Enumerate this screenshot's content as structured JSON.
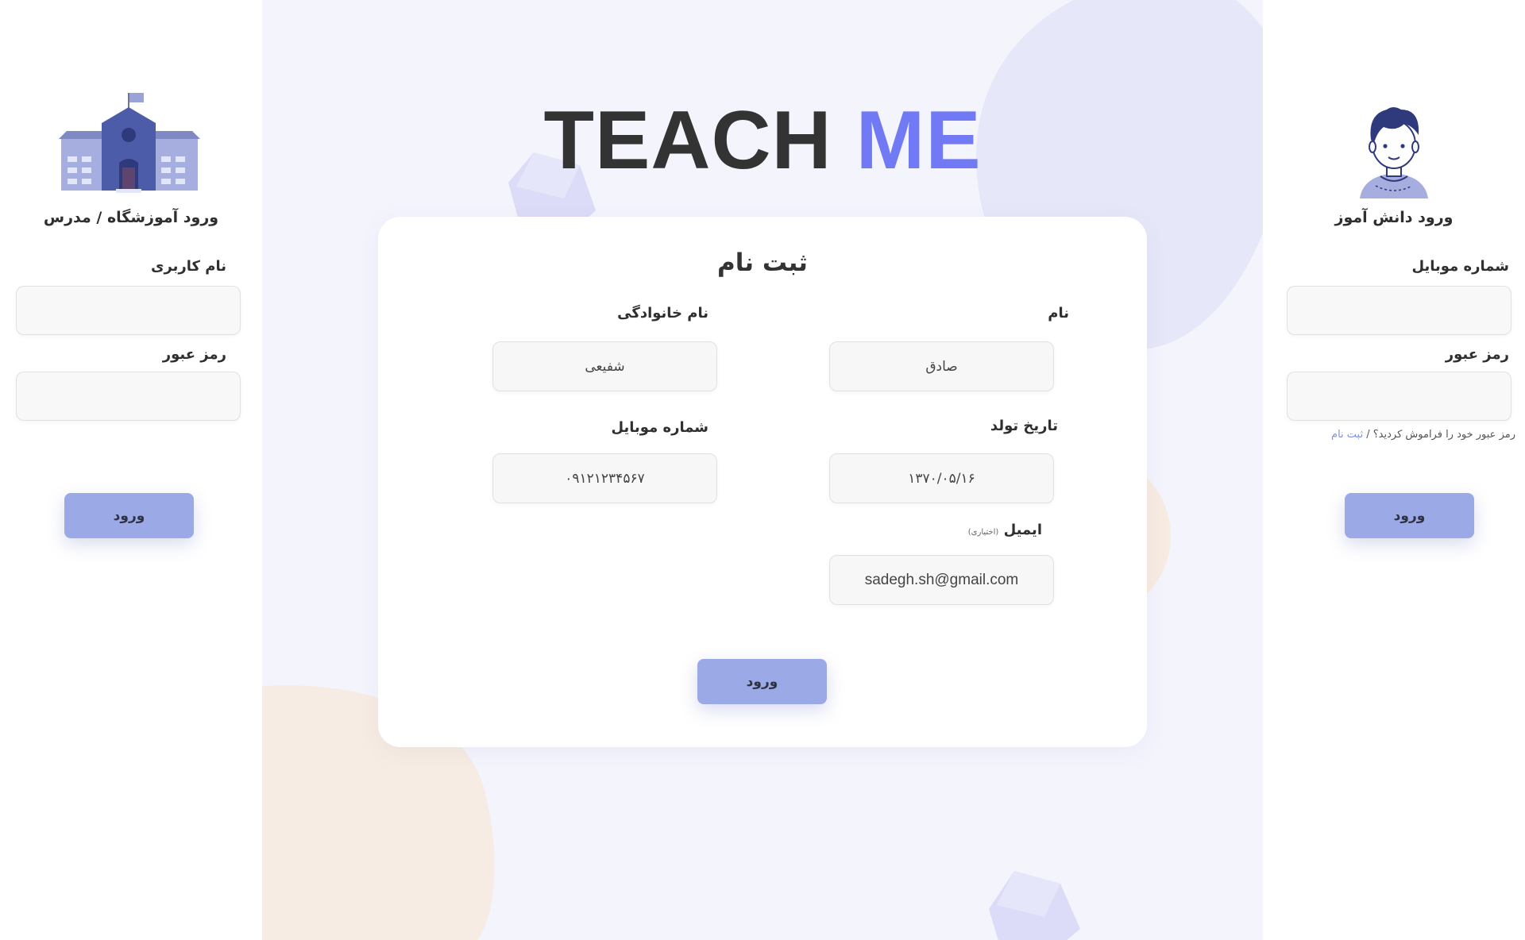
{
  "brand": {
    "word1": "TEACH",
    "word2": "ME"
  },
  "colors": {
    "accent": "#7179f4",
    "button": "#9ba9e6",
    "link": "#7f8fe0",
    "center_bg": "#f4f4fd"
  },
  "teacher_login": {
    "icon": "school-building-icon",
    "title": "ورود آموزشگاه / مدرس",
    "username_label": "نام کاربری",
    "username_value": "",
    "password_label": "رمز عبور",
    "password_value": "",
    "submit_label": "ورود"
  },
  "student_login": {
    "icon": "student-avatar-icon",
    "title": "ورود دانش آموز",
    "mobile_label": "شماره موبایل",
    "mobile_value": "",
    "password_label": "رمز عبور",
    "password_value": "",
    "forgot_text": "رمز عبور خود را فراموش کردید؟",
    "separator": " / ",
    "signup_link": "ثبت نام",
    "submit_label": "ورود"
  },
  "signup": {
    "title": "ثبت نام",
    "first_name_label": "نام",
    "first_name_value": "صادق",
    "last_name_label": "نام خانوادگی",
    "last_name_value": "شفیعی",
    "birth_date_label": "تاریخ تولد",
    "birth_date_value": "۱۳۷۰/۰۵/۱۶",
    "mobile_label": "شماره موبایل",
    "mobile_value": "۰۹۱۲۱۲۳۴۵۶۷",
    "email_label": "ایمیل",
    "email_optional": "(اختیاری)",
    "email_value": "sadegh.sh@gmail.com",
    "submit_label": "ورود"
  }
}
